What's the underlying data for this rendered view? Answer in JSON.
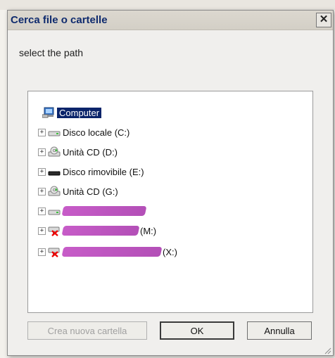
{
  "dialog": {
    "title": "Cerca file o cartelle",
    "prompt": "select the path"
  },
  "tree": {
    "root": {
      "label": "Computer",
      "icon": "computer-icon",
      "selected": true
    },
    "items": [
      {
        "label": "Disco locale (C:)",
        "icon": "hard-drive-icon"
      },
      {
        "label": "Unità CD (D:)",
        "icon": "cd-drive-icon"
      },
      {
        "label": "Disco rimovibile (E:)",
        "icon": "removable-drive-icon"
      },
      {
        "label": "Unità CD (G:)",
        "icon": "cd-drive-icon"
      },
      {
        "label": "",
        "icon": "hard-drive-icon",
        "redacted": true
      },
      {
        "label": "(M:)",
        "icon": "disconnected-network-drive-icon",
        "redacted": true
      },
      {
        "label": "(X:)",
        "icon": "disconnected-network-drive-icon",
        "redacted": true
      }
    ]
  },
  "buttons": {
    "new_folder": "Crea nuova cartella",
    "ok": "OK",
    "cancel": "Annulla"
  },
  "colors": {
    "selection": "#0a246a",
    "title_text": "#0f2b6e",
    "redaction": "#c75cc8"
  }
}
